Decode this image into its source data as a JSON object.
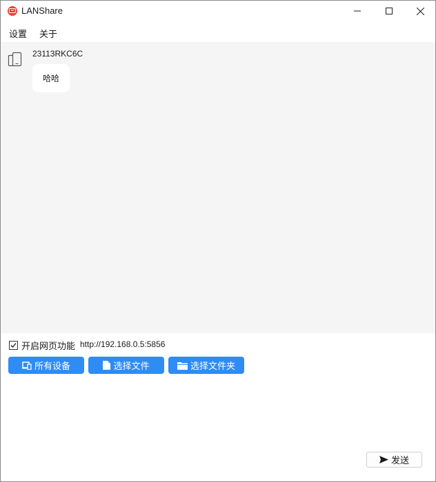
{
  "window": {
    "title": "LANShare",
    "icons": {
      "app": "app-logo-icon",
      "minimize": "minimize-icon",
      "maximize": "maximize-icon",
      "close": "close-icon"
    }
  },
  "menu": {
    "settings": "设置",
    "about": "关于"
  },
  "chat": {
    "messages": [
      {
        "sender": "23113RKC6C",
        "text": "哈哈",
        "icon": "mobile-device-icon"
      }
    ]
  },
  "web": {
    "checked": true,
    "label": "开启网页功能",
    "url": "http://192.168.0.5:5856"
  },
  "actions": {
    "all_devices": "所有设备",
    "select_file": "选择文件",
    "select_folder": "选择文件夹",
    "icons": {
      "all_devices": "devices-icon",
      "select_file": "file-icon",
      "select_folder": "folder-icon"
    }
  },
  "send": {
    "label": "发送",
    "icon": "send-arrow-icon"
  },
  "colors": {
    "accent": "#2f8cf5",
    "chat_background": "#f5f5f5",
    "app_icon": "#e8413a"
  }
}
